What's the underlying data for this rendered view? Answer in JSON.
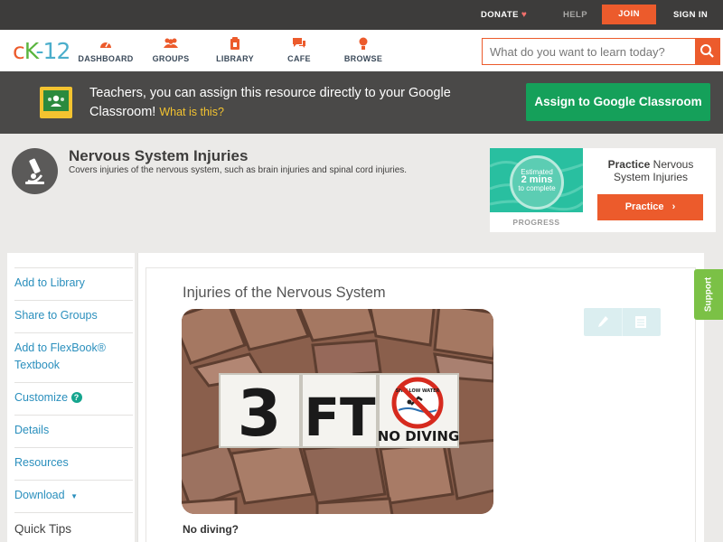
{
  "topbar": {
    "donate": "DONATE",
    "help": "HELP",
    "join": "JOIN",
    "sign_in": "SIGN IN"
  },
  "nav": {
    "logo_c": "c",
    "logo_k": "K",
    "logo_n": "-12",
    "items": [
      {
        "label": "DASHBOARD",
        "icon": "dashboard-icon"
      },
      {
        "label": "GROUPS",
        "icon": "groups-icon"
      },
      {
        "label": "LIBRARY",
        "icon": "library-icon"
      },
      {
        "label": "CAFE",
        "icon": "cafe-icon"
      },
      {
        "label": "BROWSE",
        "icon": "browse-icon"
      }
    ],
    "search_placeholder": "What do you want to learn today?"
  },
  "banner": {
    "text": "Teachers, you can assign this resource directly to your Google Classroom!",
    "what_is_this": "What is this?",
    "assign_button": "Assign to Google Classroom"
  },
  "concept": {
    "title": "Nervous System Injuries",
    "description": "Covers injuries of the nervous system, such as brain injuries and spinal cord injuries."
  },
  "practice": {
    "estimated_line1": "Estimated",
    "estimated_mins": "2 mins",
    "estimated_line3": "to complete",
    "progress_label": "PROGRESS",
    "practice_word": "Practice",
    "practice_topic": "Nervous System Injuries",
    "button": "Practice"
  },
  "sidebar": {
    "items": [
      "Add to Library",
      "Share to Groups",
      "Add to FlexBook® Textbook",
      "Customize",
      "Details",
      "Resources",
      "Download",
      "Quick Tips"
    ]
  },
  "content": {
    "section_title": "Injuries of the Nervous System",
    "caption": "No diving?",
    "tile_3": "3",
    "tile_ft": "FT",
    "tile_shallow": "SHALLOW WATER",
    "tile_no_diving": "NO DIVING"
  },
  "support": "Support",
  "colors": {
    "accent_orange": "#ec5b2c",
    "google_green": "#15a05a",
    "link_blue": "#2a8fbd",
    "support_green": "#7bc146"
  }
}
